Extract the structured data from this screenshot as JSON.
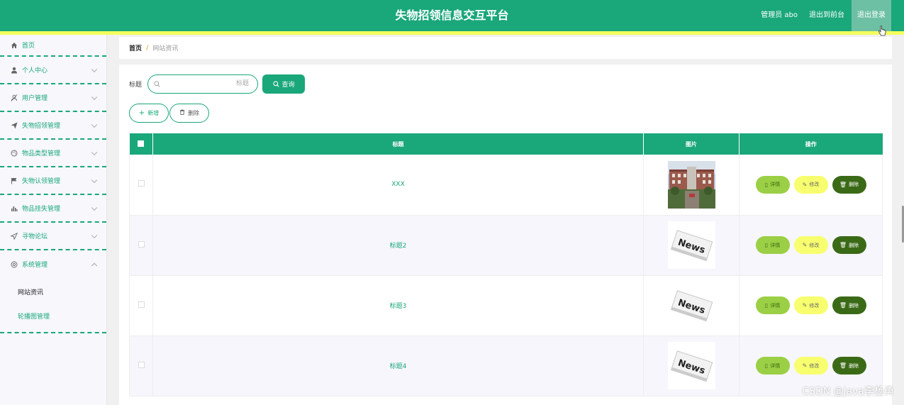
{
  "header": {
    "title": "失物招领信息交互平台",
    "admin_label": "管理员 abo",
    "back_label": "退出到前台",
    "logout_label": "退出登录"
  },
  "sidebar": {
    "items": [
      {
        "label": "首页",
        "icon": "home-icon"
      },
      {
        "label": "个人中心",
        "icon": "user-icon"
      },
      {
        "label": "用户管理",
        "icon": "users-icon"
      },
      {
        "label": "失物招领管理",
        "icon": "send-icon"
      },
      {
        "label": "物品类型管理",
        "icon": "palette-icon"
      },
      {
        "label": "失物认领管理",
        "icon": "flag-icon"
      },
      {
        "label": "物品挂失管理",
        "icon": "chart-icon"
      },
      {
        "label": "寻物论坛",
        "icon": "navigation-icon"
      },
      {
        "label": "系统管理",
        "icon": "settings-icon"
      }
    ],
    "sub_items": [
      {
        "label": "网站资讯",
        "active": true
      },
      {
        "label": "轮播图管理",
        "active": false
      }
    ]
  },
  "breadcrumb": {
    "home": "首页",
    "separator": "/",
    "current": "网站资讯"
  },
  "search": {
    "label": "标题",
    "placeholder": "标题",
    "query_label": "查询"
  },
  "actions": {
    "add_label": "新增",
    "delete_label": "删除"
  },
  "table": {
    "headers": [
      "标题",
      "图片",
      "操作"
    ],
    "rows": [
      {
        "title": "XXX",
        "image": "campus-photo"
      },
      {
        "title": "标题2",
        "image": "news-image"
      },
      {
        "title": "标题3",
        "image": "news-image"
      },
      {
        "title": "标题4",
        "image": "news-image"
      }
    ],
    "op_labels": {
      "detail": "详情",
      "edit": "修改",
      "delete": "删除"
    }
  },
  "watermark": "CSDN @java李杨勇",
  "colors": {
    "primary": "#1aa77a",
    "accent_yellow": "#f4ff5c",
    "detail_btn": "#9bcf45",
    "edit_btn": "#f8ff6e",
    "delete_btn": "#3b6a17"
  }
}
